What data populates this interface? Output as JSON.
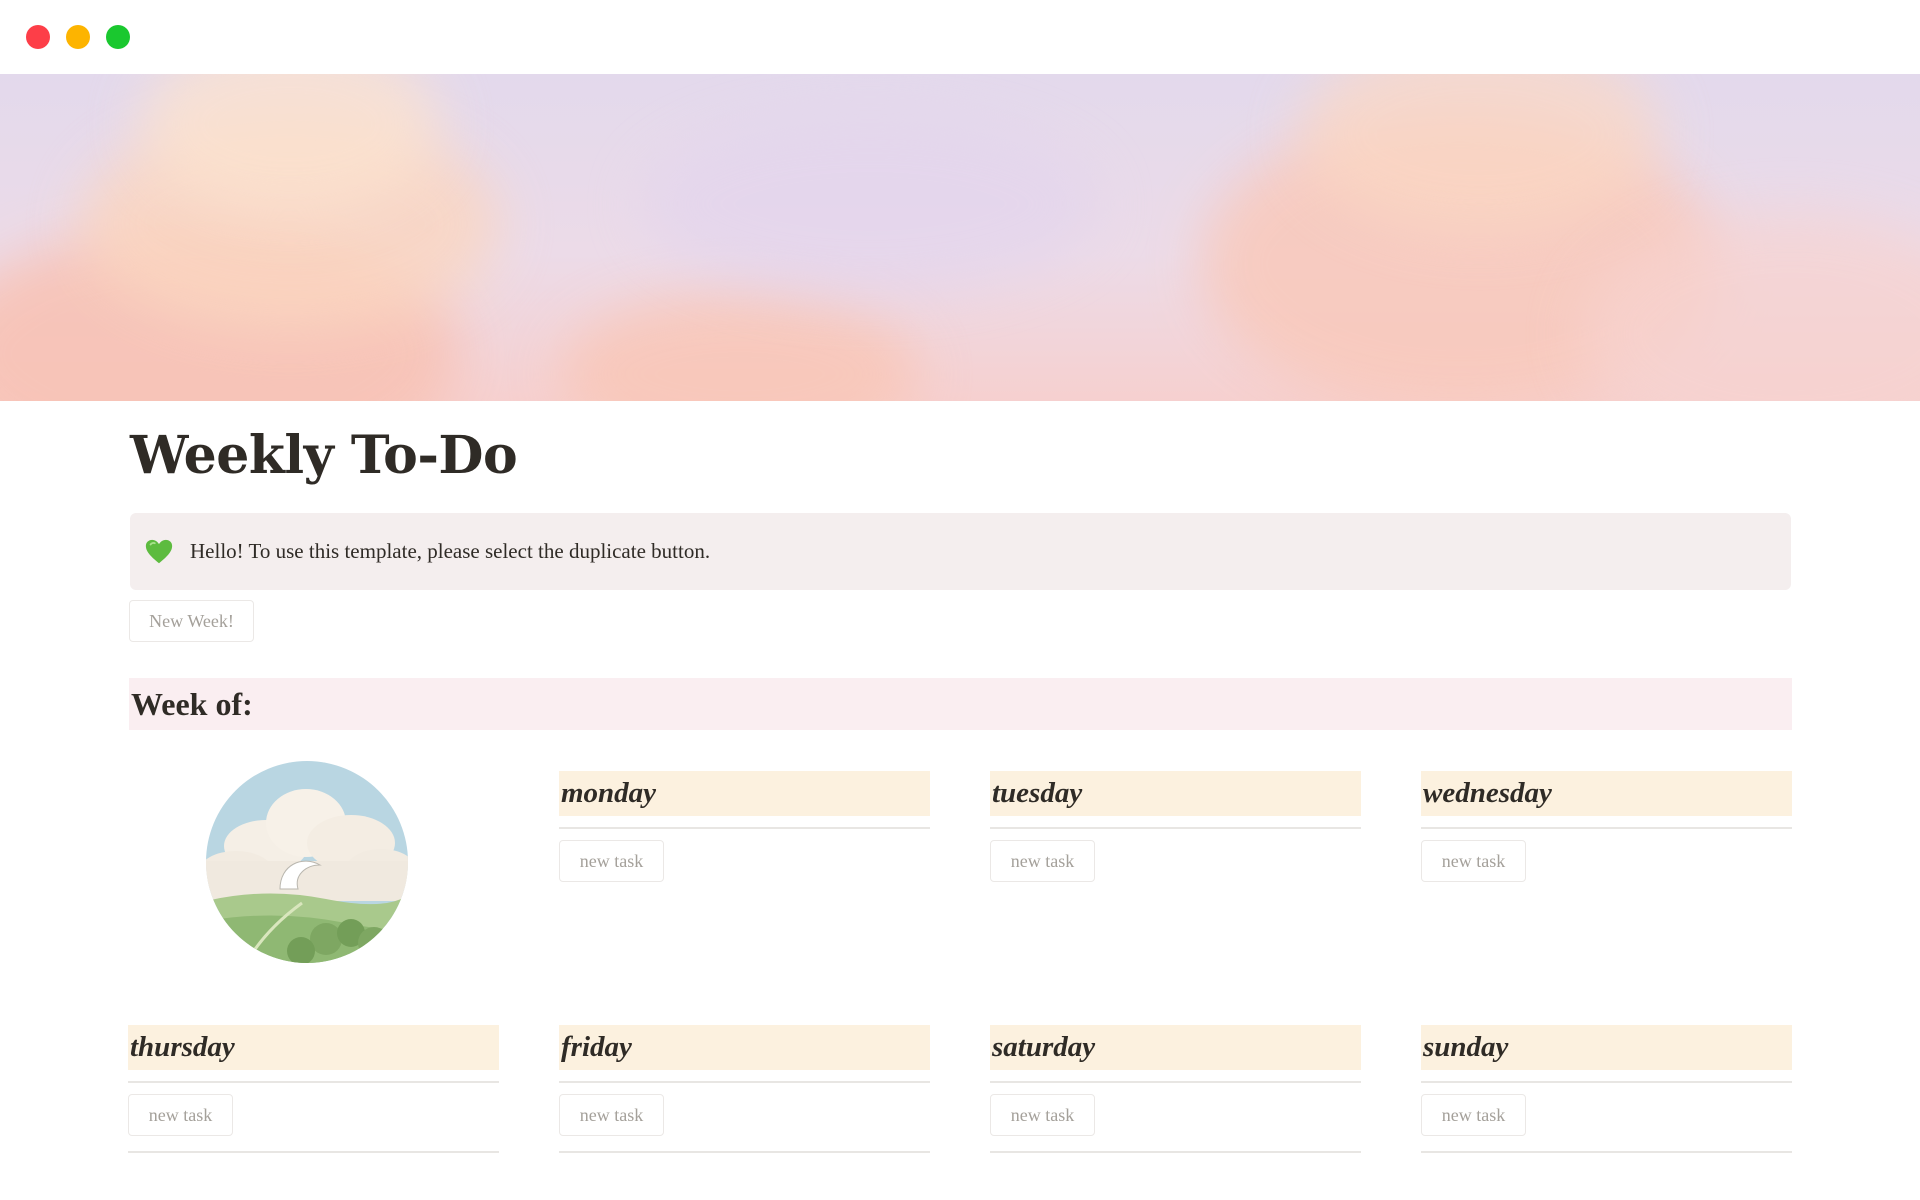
{
  "window": {
    "controls": [
      "close",
      "minimize",
      "maximize"
    ]
  },
  "page": {
    "title": "Weekly To-Do",
    "callout": {
      "icon": "green-heart-icon",
      "text": "Hello! To use this template,  please select the duplicate button."
    },
    "new_week_button": "New Week!",
    "week_heading": "Week of:"
  },
  "days": [
    {
      "name": "monday",
      "button": "new task"
    },
    {
      "name": "tuesday",
      "button": "new task"
    },
    {
      "name": "wednesday",
      "button": "new task"
    },
    {
      "name": "thursday",
      "button": "new task"
    },
    {
      "name": "friday",
      "button": "new task"
    },
    {
      "name": "saturday",
      "button": "new task"
    },
    {
      "name": "sunday",
      "button": "new task"
    }
  ],
  "colors": {
    "callout_bg": "#f4eeee",
    "week_heading_bg": "#faeef1",
    "day_header_bg": "#fcf1df",
    "muted_text": "#a4a09a"
  }
}
